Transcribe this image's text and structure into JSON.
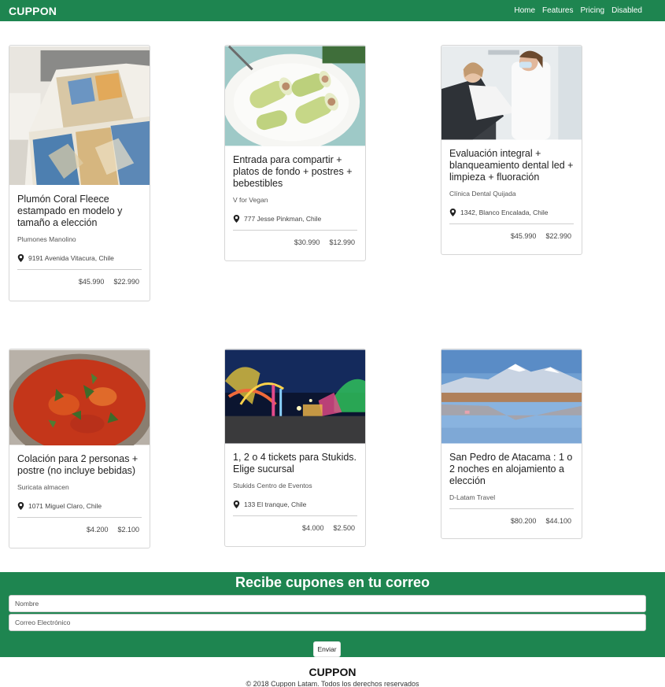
{
  "navbar": {
    "brand": "CUPPON",
    "links": [
      "Home",
      "Features",
      "Pricing",
      "Disabled"
    ]
  },
  "cards": [
    {
      "title": "Plumón Coral Fleece estampado en modelo y tamaño a elección",
      "merchant": "Plumones Manolino",
      "location": "9191 Avenida Vitacura, Chile",
      "price_original": "$45.990",
      "price_deal": "$22.990",
      "image": "bedding-comforter-photo"
    },
    {
      "title": "Entrada para compartir + platos de fondo + postres + bebestibles",
      "merchant": "V for Vegan",
      "location": "777 Jesse Pinkman, Chile",
      "price_original": "$30.990",
      "price_deal": "$12.990",
      "image": "vegan-rolls-photo"
    },
    {
      "title": "Evaluación integral + blanqueamiento dental led + limpieza + fluoración",
      "merchant": "Clínica Dental Quijada",
      "location": "1342, Blanco Encalada, Chile",
      "price_original": "$45.990",
      "price_deal": "$22.990",
      "image": "dentist-photo"
    },
    {
      "title": "Colación para 2 personas + postre (no incluye bebidas)",
      "merchant": "Suricata almacen",
      "location": "1071 Miguel Claro, Chile",
      "price_original": "$4.200",
      "price_deal": "$2.100",
      "image": "stew-photo"
    },
    {
      "title": "1, 2 o 4 tickets para Stukids. Elige sucursal",
      "merchant": "Stukids Centro de Eventos",
      "location": "133 El tranque, Chile",
      "price_original": "$4.000",
      "price_deal": "$2.500",
      "image": "fairground-photo"
    },
    {
      "title": "San Pedro de Atacama : 1 o 2 noches en alojamiento a elección",
      "merchant": "D-Latam Travel",
      "location": "",
      "price_original": "$80.200",
      "price_deal": "$44.100",
      "image": "atacama-landscape-photo"
    }
  ],
  "subscribe": {
    "title": "Recibe cupones en tu correo",
    "name_placeholder": "Nombre",
    "email_placeholder": "Correo Electrónico",
    "submit_label": "Enviar"
  },
  "footer": {
    "brand": "CUPPON",
    "copyright": "© 2018 Cuppon Latam. Todos los derechos reservados"
  },
  "colors": {
    "brand_green": "#1e8550"
  }
}
